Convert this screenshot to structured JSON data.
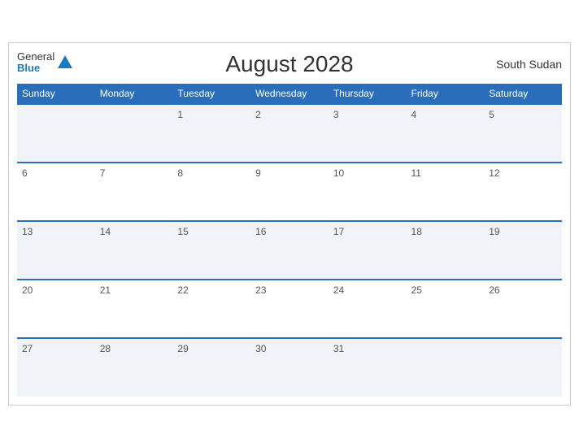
{
  "header": {
    "title": "August 2028",
    "brand_general": "General",
    "brand_blue": "Blue",
    "country": "South Sudan"
  },
  "weekdays": [
    "Sunday",
    "Monday",
    "Tuesday",
    "Wednesday",
    "Thursday",
    "Friday",
    "Saturday"
  ],
  "weeks": [
    [
      "",
      "",
      "1",
      "2",
      "3",
      "4",
      "5"
    ],
    [
      "6",
      "7",
      "8",
      "9",
      "10",
      "11",
      "12"
    ],
    [
      "13",
      "14",
      "15",
      "16",
      "17",
      "18",
      "19"
    ],
    [
      "20",
      "21",
      "22",
      "23",
      "24",
      "25",
      "26"
    ],
    [
      "27",
      "28",
      "29",
      "30",
      "31",
      "",
      ""
    ]
  ]
}
